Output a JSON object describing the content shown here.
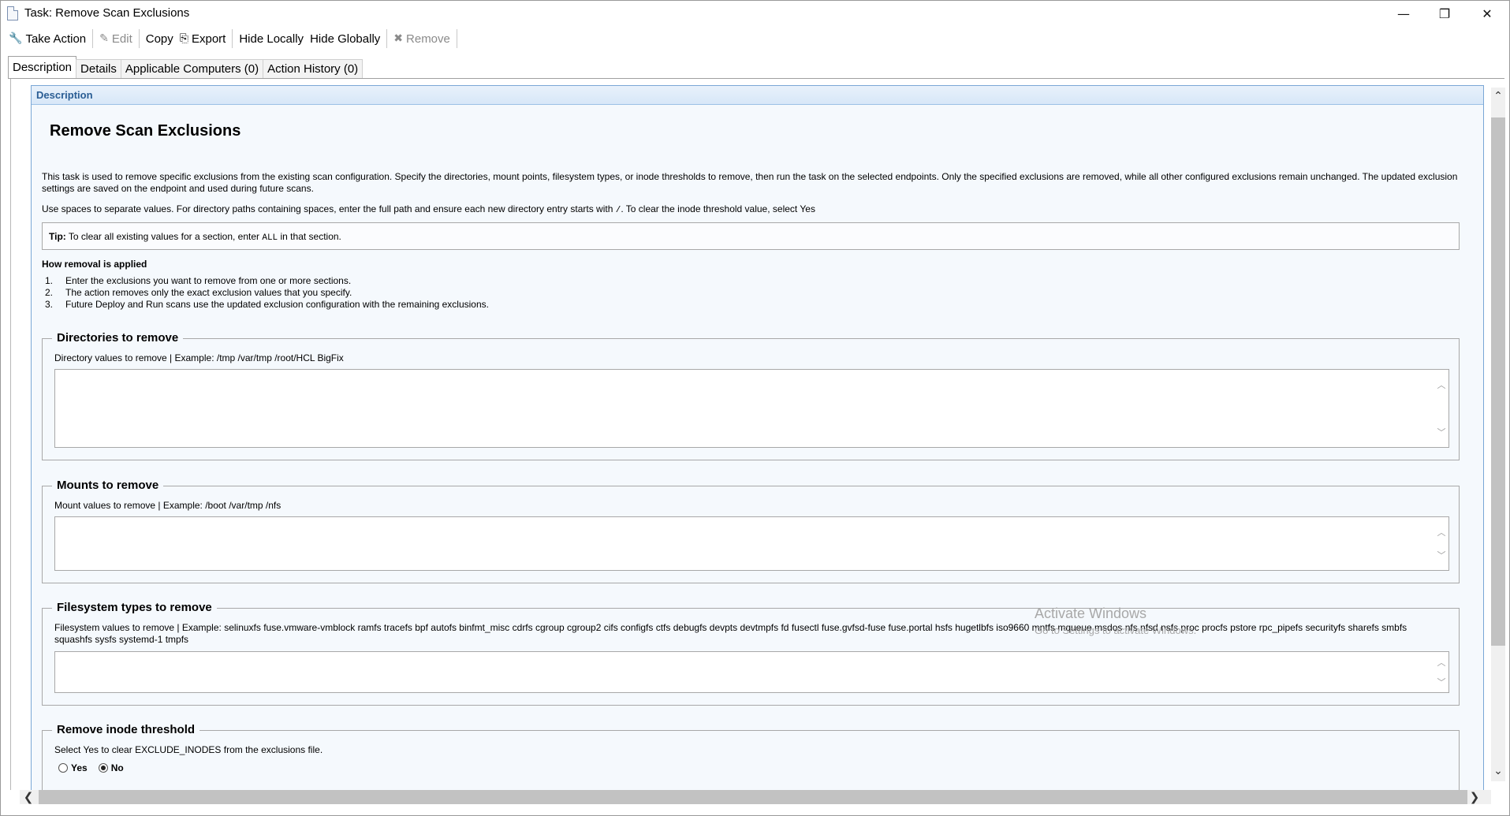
{
  "window": {
    "title": "Task: Remove Scan Exclusions",
    "minimize": "—",
    "restore": "❐",
    "close": "✕"
  },
  "toolbar": {
    "take_action": "Take Action",
    "edit": "Edit",
    "copy": "Copy",
    "export": "Export",
    "hide_locally": "Hide Locally",
    "hide_globally": "Hide Globally",
    "remove": "Remove"
  },
  "tabs": [
    {
      "label": "Description"
    },
    {
      "label": "Details"
    },
    {
      "label": "Applicable Computers (0)"
    },
    {
      "label": "Action History (0)"
    }
  ],
  "description": {
    "header": "Description",
    "title": "Remove Scan Exclusions",
    "para1": "This task is used to remove specific exclusions from the existing scan configuration. Specify the directories, mount points, filesystem types, or inode thresholds to remove, then run the task on the selected endpoints. Only the specified exclusions are removed, while all other configured exclusions remain unchanged. The updated exclusion settings are saved on the endpoint and used during future scans.",
    "para2_a": "Use spaces to separate values. For directory paths containing spaces, enter the full path and ensure each new directory entry starts with ",
    "para2_code": "/",
    "para2_b": ". To clear the inode threshold value, select Yes",
    "tip_label": "Tip:",
    "tip_a": " To clear all existing values for a section, enter ",
    "tip_code": "ALL",
    "tip_b": " in that section.",
    "how_title": "How removal is applied",
    "steps": [
      {
        "num": "1.",
        "text": "Enter the exclusions you want to remove from one or more sections."
      },
      {
        "num": "2.",
        "text": "The action removes only the exact exclusion values that you specify."
      },
      {
        "num": "3.",
        "text": "Future Deploy and Run scans use the updated exclusion configuration with the remaining exclusions."
      }
    ]
  },
  "sections": {
    "directories": {
      "legend": "Directories to remove",
      "label": "Directory values to remove | Example: /tmp /var/tmp /root/HCL BigFix",
      "value": ""
    },
    "mounts": {
      "legend": "Mounts to remove",
      "label": "Mount values to remove | Example: /boot /var/tmp /nfs",
      "value": ""
    },
    "filesystems": {
      "legend": "Filesystem types to remove",
      "label": "Filesystem values to remove | Example: selinuxfs fuse.vmware-vmblock ramfs tracefs bpf autofs binfmt_misc cdrfs cgroup cgroup2 cifs configfs ctfs debugfs devpts devtmpfs fd fusectl fuse.gvfsd-fuse fuse.portal hsfs hugetlbfs iso9660 mntfs mqueue msdos nfs nfsd nsfs proc procfs pstore rpc_pipefs securityfs sharefs smbfs squashfs sysfs systemd-1 tmpfs",
      "value": ""
    },
    "inode": {
      "legend": "Remove inode threshold",
      "label": "Select Yes to clear EXCLUDE_INODES from the exclusions file.",
      "yes": "Yes",
      "no": "No",
      "selected": "No"
    }
  },
  "watermark": {
    "line1": "Activate Windows",
    "line2": "Go to Settings to activate Windows."
  },
  "icons": {
    "scroll_up": "︿",
    "scroll_down": "﹀",
    "vscroll_up": "⌃",
    "vscroll_down": "⌄",
    "hscroll_left": "❮",
    "hscroll_right": "❯"
  }
}
